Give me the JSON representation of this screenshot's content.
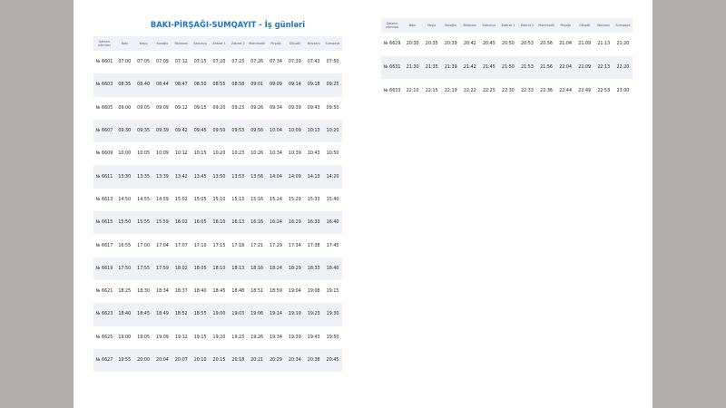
{
  "title": "BAKI-PİRŞAĞI-SUMQAYIT - İş günləri",
  "headers": [
    "Qatarın nömrəsi",
    "Bakı",
    "Keşlə",
    "Koroğlu",
    "Balaxanı",
    "Sabunçu",
    "Zabrat 1",
    "Zabrat 2",
    "Məmmədli",
    "Pirşağı",
    "Görədil",
    "Novxanı",
    "Sumqayıt"
  ],
  "left_rows": [
    [
      "№ 6601",
      "07:00",
      "07:05",
      "07:09",
      "07:12",
      "07:15",
      "07:20",
      "07:23",
      "07:26",
      "07:34",
      "07:39",
      "07:43",
      "07:50"
    ],
    [
      "№ 6603",
      "08:35",
      "08:40",
      "08:44",
      "08:47",
      "08:50",
      "08:55",
      "08:58",
      "09:01",
      "09:09",
      "09:14",
      "09:18",
      "09:25"
    ],
    [
      "№ 6605",
      "09:00",
      "09:05",
      "09:09",
      "09:12",
      "09:15",
      "09:20",
      "09:23",
      "09:26",
      "09:34",
      "09:39",
      "09:43",
      "09:50"
    ],
    [
      "№ 6607",
      "09:30",
      "09:35",
      "09:39",
      "09:42",
      "09:45",
      "09:50",
      "09:53",
      "09:56",
      "10:04",
      "10:09",
      "10:13",
      "10:20"
    ],
    [
      "№ 6609",
      "10:00",
      "10:05",
      "10:09",
      "10:12",
      "10:15",
      "10:20",
      "10:23",
      "10:26",
      "10:34",
      "10:39",
      "10:43",
      "10:50"
    ],
    [
      "№ 6611",
      "13:30",
      "13:35",
      "13:39",
      "13:42",
      "13:45",
      "13:50",
      "13:53",
      "13:56",
      "14:04",
      "14:09",
      "14:13",
      "14:20"
    ],
    [
      "№ 6613",
      "14:50",
      "14:55",
      "14:59",
      "15:02",
      "15:05",
      "15:10",
      "15:13",
      "15:16",
      "15:24",
      "15:29",
      "15:33",
      "15:40"
    ],
    [
      "№ 6615",
      "15:50",
      "15:55",
      "15:59",
      "16:02",
      "16:05",
      "16:10",
      "16:13",
      "16:16",
      "16:24",
      "16:29",
      "16:33",
      "16:40"
    ],
    [
      "№ 6617",
      "16:55",
      "17:00",
      "17:04",
      "17:07",
      "17:10",
      "17:15",
      "17:18",
      "17:21",
      "17:29",
      "17:34",
      "17:38",
      "17:45"
    ],
    [
      "№ 6619",
      "17:50",
      "17:55",
      "17:59",
      "18:02",
      "18:05",
      "18:10",
      "18:13",
      "18:16",
      "18:24",
      "18:29",
      "18:33",
      "18:40"
    ],
    [
      "№ 6621",
      "18:25",
      "18:30",
      "18:34",
      "18:37",
      "18:40",
      "18:45",
      "18:48",
      "18:51",
      "18:59",
      "19:04",
      "19:08",
      "19:15"
    ],
    [
      "№ 6623",
      "18:40",
      "18:45",
      "18:49",
      "18:52",
      "18:55",
      "19:00",
      "19:03",
      "19:06",
      "19:14",
      "19:19",
      "19:23",
      "19:30"
    ],
    [
      "№ 6625",
      "19:00",
      "19:05",
      "19:09",
      "19:12",
      "19:15",
      "19:20",
      "19:23",
      "19:26",
      "19:34",
      "19:39",
      "19:43",
      "19:50"
    ],
    [
      "№ 6627",
      "19:55",
      "20:00",
      "20:04",
      "20:07",
      "20:10",
      "20:15",
      "20:18",
      "20:21",
      "20:29",
      "20:34",
      "20:38",
      "20:45"
    ]
  ],
  "right_rows": [
    [
      "№ 6629",
      "20:30",
      "20:35",
      "20:39",
      "20:42",
      "20:45",
      "20:50",
      "20:53",
      "20:56",
      "21:04",
      "21:09",
      "21:13",
      "21:20"
    ],
    [
      "№ 6631",
      "21:30",
      "21:35",
      "21:39",
      "21:42",
      "21:45",
      "21:50",
      "21:53",
      "21:56",
      "22:04",
      "22:09",
      "22:13",
      "22:20"
    ],
    [
      "№ 6633",
      "22:10",
      "22:15",
      "22:19",
      "22:22",
      "22:25",
      "22:30",
      "22:33",
      "22:36",
      "22:44",
      "22:49",
      "22:53",
      "23:00"
    ]
  ]
}
